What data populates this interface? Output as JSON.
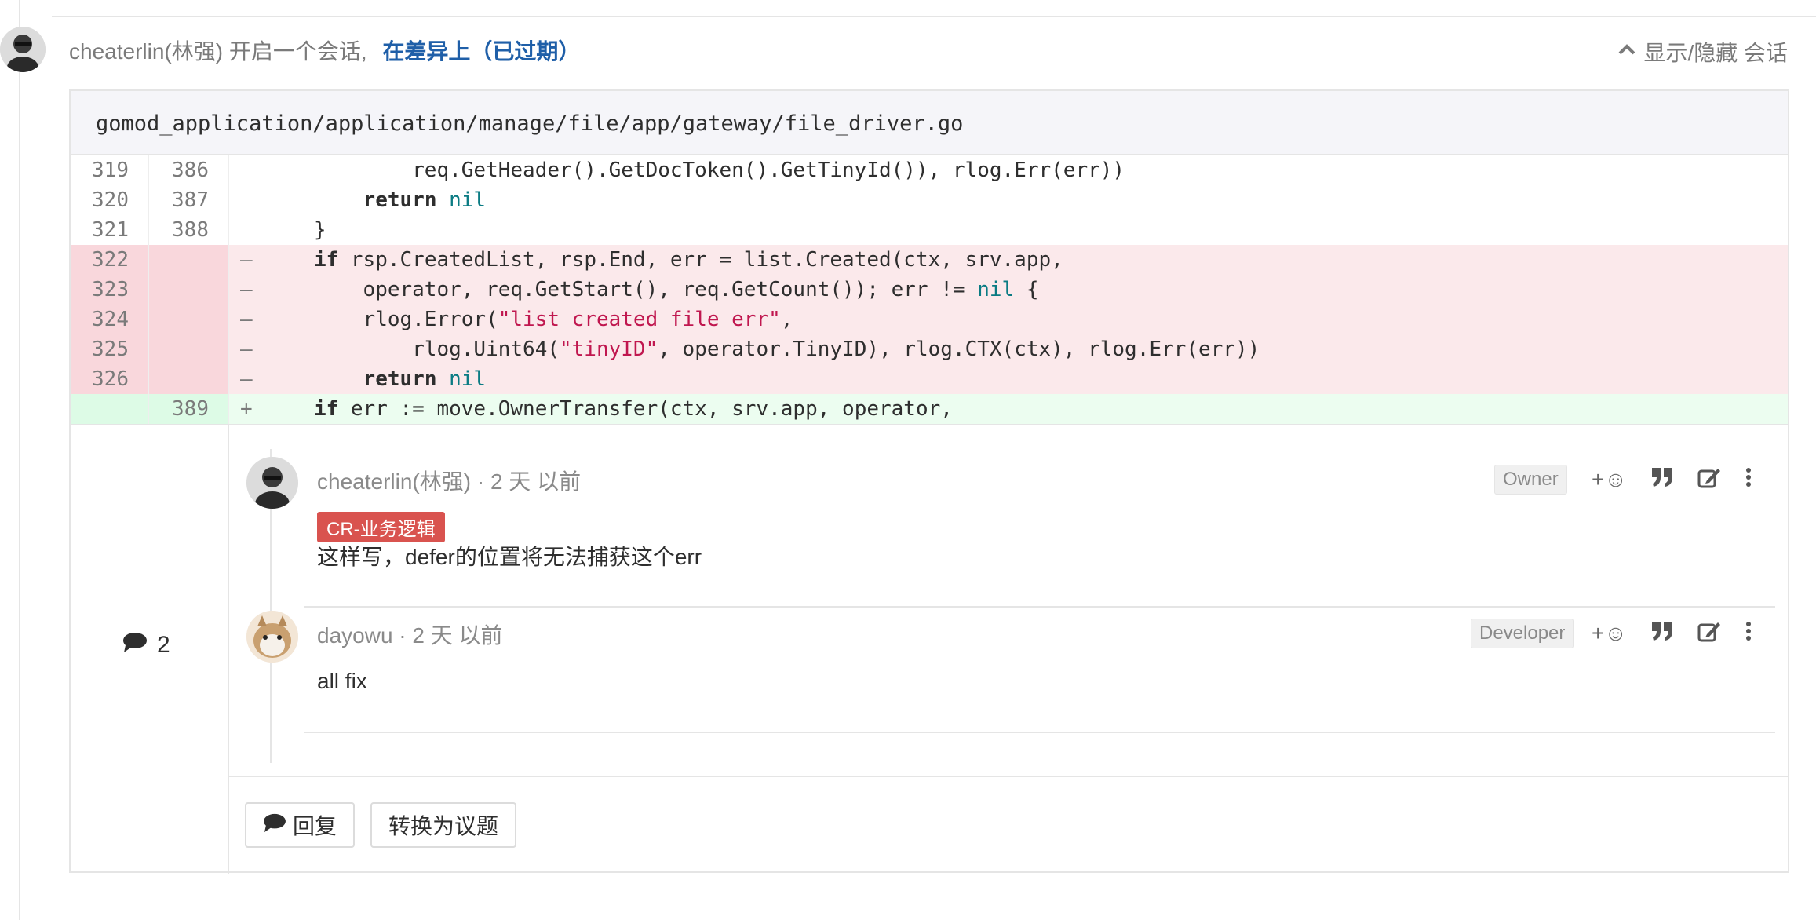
{
  "discussion": {
    "author": "cheaterlin(林强)",
    "action": "开启一个会话,",
    "target_link": "在差异上（已过期）",
    "toggle_label": "显示/隐藏 会话"
  },
  "file": {
    "path": "gomod_application/application/manage/file/app/gateway/file_driver.go"
  },
  "diff_lines": [
    {
      "old": "319",
      "new": "386",
      "type": "context",
      "sign": "",
      "code": "          req.GetHeader().GetDocToken().GetTinyId()), rlog.Err(err))"
    },
    {
      "old": "320",
      "new": "387",
      "type": "context",
      "sign": "",
      "code_parts": [
        [
          "      ",
          ""
        ],
        [
          "return",
          "kw"
        ],
        [
          " ",
          ""
        ],
        [
          "nil",
          "nil"
        ]
      ]
    },
    {
      "old": "321",
      "new": "388",
      "type": "context",
      "sign": "",
      "code": "  }"
    },
    {
      "old": "322",
      "new": "",
      "type": "del",
      "sign": "–",
      "code_parts": [
        [
          "  ",
          ""
        ],
        [
          "if",
          "kw"
        ],
        [
          " rsp.CreatedList, rsp.End, err = list.Created(ctx, srv.app,",
          ""
        ]
      ]
    },
    {
      "old": "323",
      "new": "",
      "type": "del",
      "sign": "–",
      "code_parts": [
        [
          "      operator, req.GetStart(), req.GetCount()); err != ",
          ""
        ],
        [
          "nil",
          "nil"
        ],
        [
          " {",
          ""
        ]
      ]
    },
    {
      "old": "324",
      "new": "",
      "type": "del",
      "sign": "–",
      "code_parts": [
        [
          "      rlog.Error(",
          ""
        ],
        [
          "\"list created file err\"",
          "str"
        ],
        [
          ",",
          ""
        ]
      ]
    },
    {
      "old": "325",
      "new": "",
      "type": "del",
      "sign": "–",
      "code_parts": [
        [
          "          rlog.Uint64(",
          ""
        ],
        [
          "\"tinyID\"",
          "str"
        ],
        [
          ", operator.TinyID), rlog.CTX(ctx), rlog.Err(err))",
          ""
        ]
      ]
    },
    {
      "old": "326",
      "new": "",
      "type": "del",
      "sign": "–",
      "code_parts": [
        [
          "      ",
          ""
        ],
        [
          "return",
          "kw"
        ],
        [
          " ",
          ""
        ],
        [
          "nil",
          "nil"
        ]
      ]
    },
    {
      "old": "",
      "new": "389",
      "type": "add",
      "sign": "+",
      "code_parts": [
        [
          "  ",
          ""
        ],
        [
          "if",
          "kw"
        ],
        [
          " err := move.OwnerTransfer(ctx, srv.app, operator,",
          ""
        ]
      ]
    }
  ],
  "notes": {
    "count": "2",
    "items": [
      {
        "author": "cheaterlin(林强)",
        "time": "· 2 天 以前",
        "role": "Owner",
        "label": "CR-业务逻辑",
        "body": "这样写，defer的位置将无法捕获这个err"
      },
      {
        "author": "dayowu",
        "time": "· 2 天 以前",
        "role": "Developer",
        "label": "",
        "body": "all fix"
      }
    ],
    "actions": [
      "award-emoji-icon",
      "quote-icon",
      "edit-icon",
      "more-icon"
    ],
    "emoji_label": "+☺",
    "reply_button": "回复",
    "convert_button": "转换为议题"
  },
  "colors": {
    "link": "#1f5fa8",
    "label_red": "#d9534f",
    "del_bg": "#fbe9eb",
    "add_bg": "#ecfdf0",
    "string": "#c0174f",
    "nil": "#0a7b83"
  }
}
